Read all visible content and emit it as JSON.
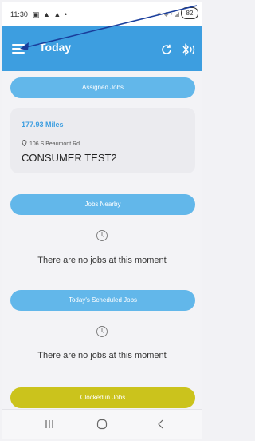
{
  "status_bar": {
    "time": "11:30",
    "left_icons": "▣ ▲ ▲ •",
    "right_icons": "✶ ◆ • ◢",
    "battery": "82"
  },
  "app_bar": {
    "title": "Today",
    "menu_icon": "hamburger-menu-icon",
    "refresh_icon": "refresh-icon",
    "bluetooth_icon": "bluetooth-signal-icon",
    "color": "#3d9ee0"
  },
  "sections": {
    "assigned": {
      "label": "Assigned Jobs"
    },
    "nearby": {
      "label": "Jobs Nearby",
      "empty_text": "There are no jobs at this moment"
    },
    "scheduled": {
      "label": "Today's Scheduled Jobs",
      "empty_text": "There are no jobs at this moment"
    },
    "clocked": {
      "label": "Clocked in Jobs",
      "color": "#cbc31c"
    }
  },
  "assigned_job": {
    "distance": "177.93 Miles",
    "address": "106 S Beaumont Rd",
    "name": "CONSUMER TEST2",
    "pin_icon": "location-pin-icon"
  },
  "nav_bar": {
    "icons": [
      "recents-icon",
      "home-icon",
      "back-icon"
    ]
  }
}
